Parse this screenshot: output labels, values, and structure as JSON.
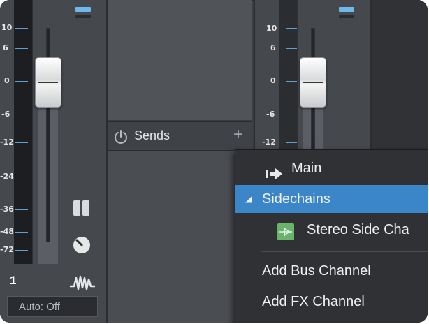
{
  "left_strip": {
    "scale": [
      "10",
      "6",
      "0",
      "-6",
      "-12",
      "-24",
      "-36",
      "-48",
      "-72"
    ],
    "channel_number": "1",
    "automation_label": "Auto: Off"
  },
  "right_strip": {
    "scale": [
      "10",
      "6",
      "0",
      "-6",
      "-12"
    ]
  },
  "sends": {
    "label": "Sends",
    "power_icon": "power-icon",
    "add_icon": "plus-icon"
  },
  "menu": {
    "main_label": "Main",
    "sidechains_label": "Sidechains",
    "stereo_side_label": "Stereo Side Cha",
    "add_bus_label": "Add Bus Channel",
    "add_fx_label": "Add FX Channel"
  },
  "colors": {
    "highlight": "#3b86c8",
    "meter_tick": "#5aa0d6",
    "led_blue": "#6fb9ea",
    "sidechain_icon": "#69b36a"
  }
}
